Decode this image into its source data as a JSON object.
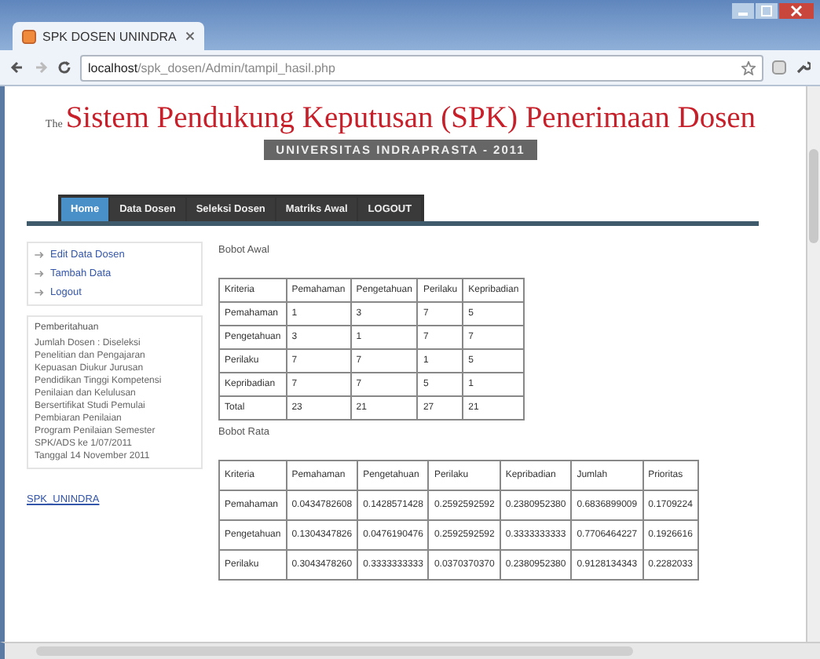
{
  "browser": {
    "tab_title": "SPK DOSEN UNINDRA",
    "url_host": "localhost",
    "url_path": "/spk_dosen/Admin/tampil_hasil.php"
  },
  "header": {
    "prefix": "The",
    "title": "Sistem Pendukung Keputusan (SPK) Penerimaan Dosen",
    "subtitle": "UNIVERSITAS INDRAPRASTA - 2011"
  },
  "nav": [
    {
      "label": "Home",
      "selected": true
    },
    {
      "label": "Data Dosen",
      "selected": false
    },
    {
      "label": "Seleksi Dosen",
      "selected": false
    },
    {
      "label": "Matriks Awal",
      "selected": false
    },
    {
      "label": "LOGOUT",
      "selected": false
    }
  ],
  "sidebar": {
    "links": [
      "Edit Data Dosen",
      "Tambah Data",
      "Logout"
    ],
    "notice_title": "Pemberitahuan",
    "notice_lines": [
      "Jumlah Dosen : Diseleksi",
      "Penelitian dan Pengajaran",
      "Kepuasan Diukur Jurusan",
      "Pendidikan Tinggi Kompetensi",
      "Penilaian dan Kelulusan",
      "Bersertifikat Studi Pemulai",
      "Pembiaran Penilaian",
      "Program Penilaian Semester",
      "SPK/ADS ke 1/07/2011",
      "Tanggal 14 November 2011"
    ],
    "footer_link": "SPK_UNINDRA"
  },
  "matrix": {
    "title": "Bobot Awal",
    "columns": [
      "Kriteria",
      "Pemahaman",
      "Pengetahuan",
      "Perilaku",
      "Kepribadian"
    ],
    "rows": [
      [
        "Pemahaman",
        "1",
        "3",
        "7",
        "5"
      ],
      [
        "Pengetahuan",
        "3",
        "1",
        "7",
        "7"
      ],
      [
        "Perilaku",
        "7",
        "7",
        "1",
        "5"
      ],
      [
        "Kepribadian",
        "7",
        "7",
        "5",
        "1"
      ],
      [
        "Total",
        "23",
        "21",
        "27",
        "21"
      ]
    ]
  },
  "weights": {
    "title": "Bobot Rata",
    "columns": [
      "Kriteria",
      "Pemahaman",
      "Pengetahuan",
      "Perilaku",
      "Kepribadian",
      "Jumlah",
      "Prioritas"
    ],
    "rows": [
      [
        "Pemahaman",
        "0.0434782608",
        "0.1428571428",
        "0.2592592592",
        "0.2380952380",
        "0.6836899009",
        "0.1709224"
      ],
      [
        "Pengetahuan",
        "0.1304347826",
        "0.0476190476",
        "0.2592592592",
        "0.3333333333",
        "0.7706464227",
        "0.1926616"
      ],
      [
        "Perilaku",
        "0.3043478260",
        "0.3333333333",
        "0.0370370370",
        "0.2380952380",
        "0.9128134343",
        "0.2282033"
      ]
    ]
  }
}
